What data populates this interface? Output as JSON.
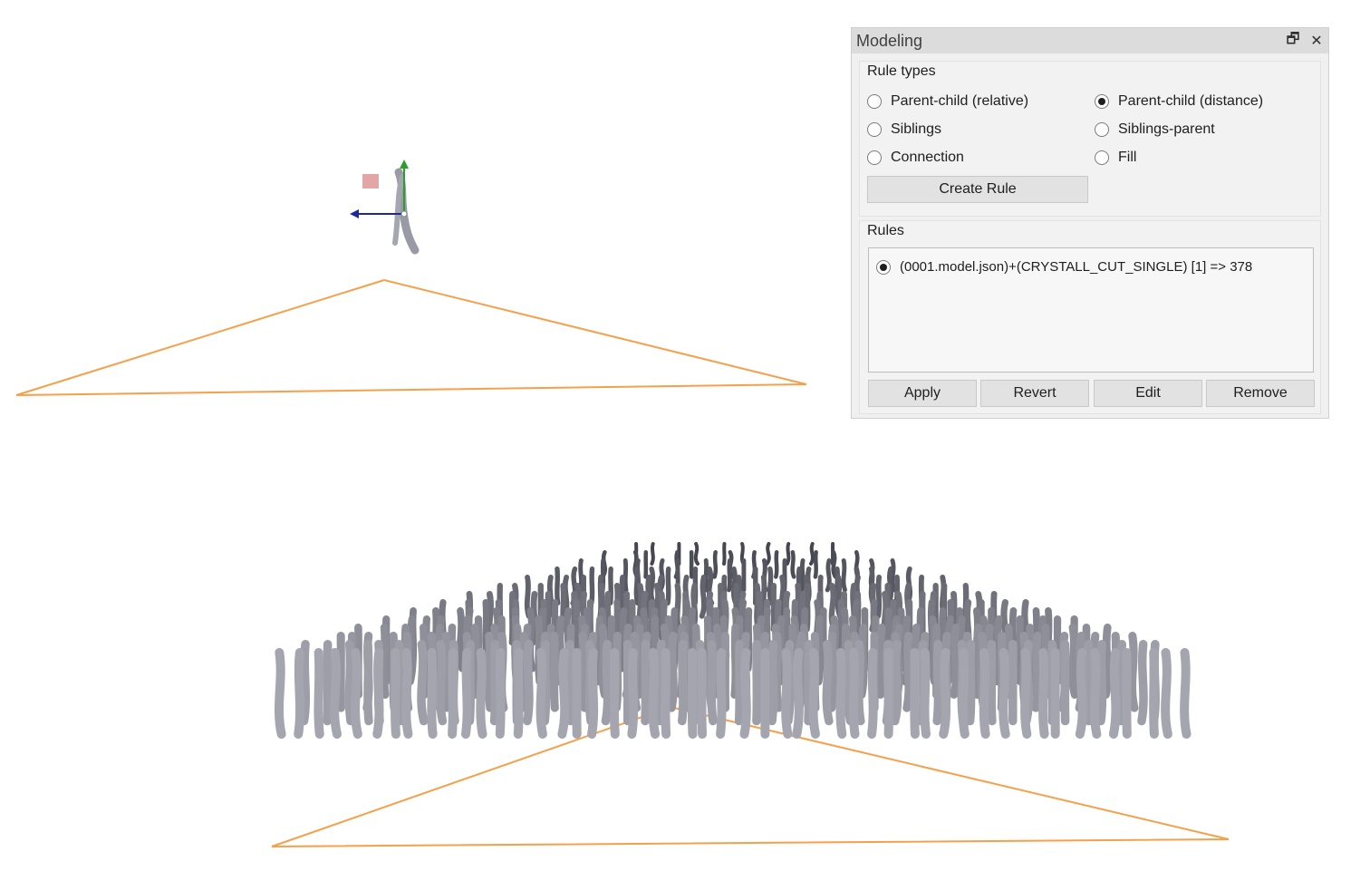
{
  "panel": {
    "title": "Modeling",
    "float_icon": "🗗",
    "close_icon": "✕",
    "rule_types": {
      "label": "Rule types",
      "options": [
        {
          "label": "Parent-child (relative)",
          "checked": false
        },
        {
          "label": "Parent-child (distance)",
          "checked": true
        },
        {
          "label": "Siblings",
          "checked": false
        },
        {
          "label": "Siblings-parent",
          "checked": false
        },
        {
          "label": "Connection",
          "checked": false
        },
        {
          "label": "Fill",
          "checked": false
        }
      ],
      "create_button": "Create Rule"
    },
    "rules": {
      "label": "Rules",
      "items": [
        {
          "text": "(0001.model.json)+(CRYSTALL_CUT_SINGLE) [1] => 378",
          "checked": true
        }
      ]
    },
    "buttons": {
      "apply": "Apply",
      "revert": "Revert",
      "edit": "Edit",
      "remove": "Remove"
    }
  },
  "scene": {
    "outline_color": "#f5a04a",
    "axis_colors": {
      "y": "#2aa02a",
      "x": "#1a2a9a",
      "z": "#e0a0a0"
    },
    "model_color": "#9a9aa6"
  }
}
